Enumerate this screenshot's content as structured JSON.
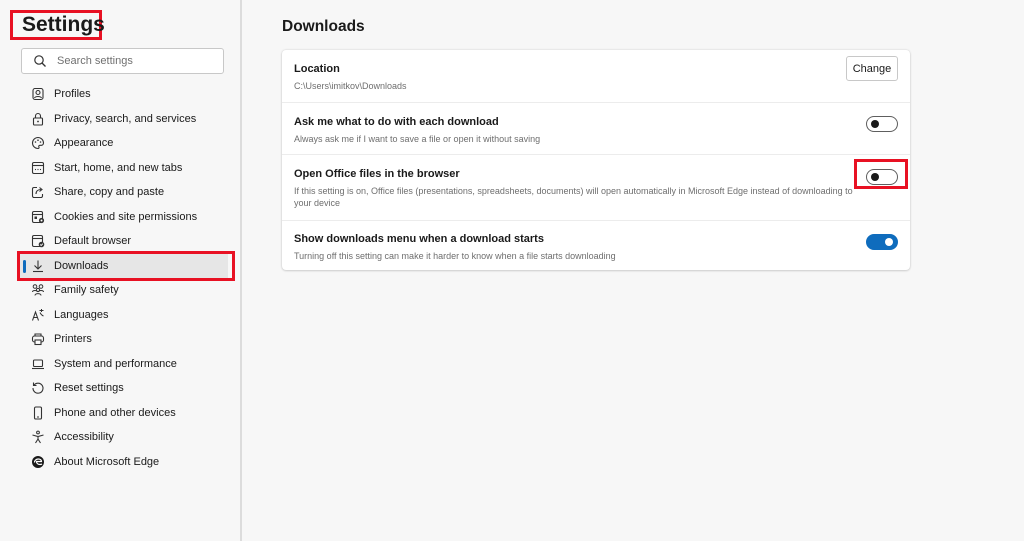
{
  "sidebar": {
    "title": "Settings",
    "search_placeholder": "Search settings",
    "items": [
      {
        "label": "Profiles",
        "icon": "profile-icon"
      },
      {
        "label": "Privacy, search, and services",
        "icon": "lock-icon"
      },
      {
        "label": "Appearance",
        "icon": "palette-icon"
      },
      {
        "label": "Start, home, and new tabs",
        "icon": "home-tab-icon"
      },
      {
        "label": "Share, copy and paste",
        "icon": "share-icon"
      },
      {
        "label": "Cookies and site permissions",
        "icon": "cookies-icon"
      },
      {
        "label": "Default browser",
        "icon": "default-browser-icon"
      },
      {
        "label": "Downloads",
        "icon": "download-icon",
        "active": true
      },
      {
        "label": "Family safety",
        "icon": "family-icon"
      },
      {
        "label": "Languages",
        "icon": "languages-icon"
      },
      {
        "label": "Printers",
        "icon": "printer-icon"
      },
      {
        "label": "System and performance",
        "icon": "laptop-icon"
      },
      {
        "label": "Reset settings",
        "icon": "reset-icon"
      },
      {
        "label": "Phone and other devices",
        "icon": "phone-icon"
      },
      {
        "label": "Accessibility",
        "icon": "accessibility-icon"
      },
      {
        "label": "About Microsoft Edge",
        "icon": "edge-logo-icon"
      }
    ]
  },
  "main": {
    "title": "Downloads",
    "location": {
      "title": "Location",
      "path": "C:\\Users\\imitkov\\Downloads",
      "button_label": "Change"
    },
    "settings": [
      {
        "title": "Ask me what to do with each download",
        "description": "Always ask me if I want to save a file or open it without saving",
        "enabled": false
      },
      {
        "title": "Open Office files in the browser",
        "description": "If this setting is on, Office files (presentations, spreadsheets, documents) will open automatically in Microsoft Edge instead of downloading to your device",
        "enabled": false
      },
      {
        "title": "Show downloads menu when a download starts",
        "description": "Turning off this setting can make it harder to know when a file starts downloading",
        "enabled": true
      }
    ]
  },
  "colors": {
    "accent": "#0f6cbd",
    "highlight": "#e81123"
  }
}
